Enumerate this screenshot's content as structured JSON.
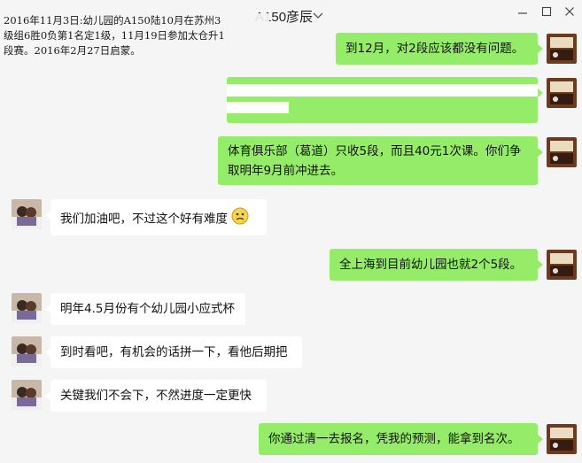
{
  "window": {
    "title": "A150彦辰",
    "controls": [
      "minimize-icon",
      "maximize-icon",
      "close-icon"
    ]
  },
  "note": {
    "text": "2016年11月3日:幼儿园的A150陆10月在苏州3\n级组6胜0负第1名定1级，11月19日参加太仓升1\n段赛。2016年2月27日启蒙。"
  },
  "messages": [
    {
      "side": "out",
      "text": "到12月，对2段应该都没有问题。"
    },
    {
      "side": "out",
      "text": "",
      "redacted": true
    },
    {
      "side": "out",
      "text": "体育俱乐部（葛道）只收5段，而且40元1次课。你们争取明年9月前冲进去。"
    },
    {
      "side": "in",
      "text": "我们加油吧，不过这个好有难度",
      "emoji": "worried-face-icon"
    },
    {
      "side": "out",
      "text": "全上海到目前幼儿园也就2个5段。"
    },
    {
      "side": "in",
      "text": "明年4.5月份有个幼儿园小应式杯"
    },
    {
      "side": "in",
      "text": "到时看吧，有机会的话拼一下，看他后期把"
    },
    {
      "side": "in",
      "text": "关键我们不会下，不然进度一定更快"
    },
    {
      "side": "out",
      "text": "你通过清一去报名，凭我的预测，能拿到名次。"
    }
  ],
  "colors": {
    "outgoing_bubble": "#95ec69",
    "incoming_bubble": "#ffffff",
    "background": "#f5f5f5"
  }
}
